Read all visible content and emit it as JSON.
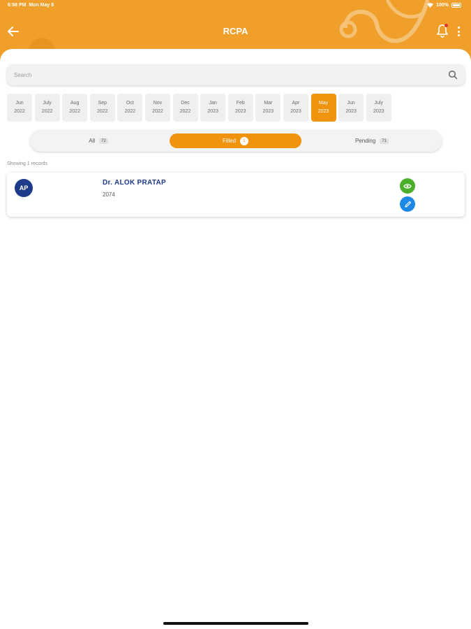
{
  "status_bar": {
    "time": "6:58 PM",
    "date": "Mon May 8",
    "battery": "100%"
  },
  "header": {
    "title": "RCPA"
  },
  "search": {
    "placeholder": "Search"
  },
  "months": [
    {
      "month": "Jun",
      "year": "2022",
      "active": false
    },
    {
      "month": "July",
      "year": "2022",
      "active": false
    },
    {
      "month": "Aug",
      "year": "2022",
      "active": false
    },
    {
      "month": "Sep",
      "year": "2022",
      "active": false
    },
    {
      "month": "Oct",
      "year": "2022",
      "active": false
    },
    {
      "month": "Nov",
      "year": "2022",
      "active": false
    },
    {
      "month": "Dec",
      "year": "2022",
      "active": false
    },
    {
      "month": "Jan",
      "year": "2023",
      "active": false
    },
    {
      "month": "Feb",
      "year": "2023",
      "active": false
    },
    {
      "month": "Mar",
      "year": "2023",
      "active": false
    },
    {
      "month": "Apr",
      "year": "2023",
      "active": false
    },
    {
      "month": "May",
      "year": "2023",
      "active": true
    },
    {
      "month": "Jun",
      "year": "2023",
      "active": false
    },
    {
      "month": "July",
      "year": "2023",
      "active": false
    }
  ],
  "tabs": {
    "all": {
      "label": "All",
      "count": "72"
    },
    "filled": {
      "label": "Filled",
      "count": "1"
    },
    "pending": {
      "label": "Pending",
      "count": "71"
    }
  },
  "records_note": "Showing 1 records",
  "record": {
    "initials": "AP",
    "name": "Dr. ALOK  PRATAP",
    "code": "2074"
  },
  "colors": {
    "accent": "#f0940f",
    "header": "#f0a02a",
    "view": "#4caf2a",
    "edit": "#1e88e5",
    "avatar": "#1e3a8a"
  },
  "icons": {
    "back": "arrow-left-icon",
    "bell": "bell-icon",
    "more": "more-vertical-icon",
    "search": "search-icon",
    "view": "eye-icon",
    "edit": "pencil-icon"
  }
}
